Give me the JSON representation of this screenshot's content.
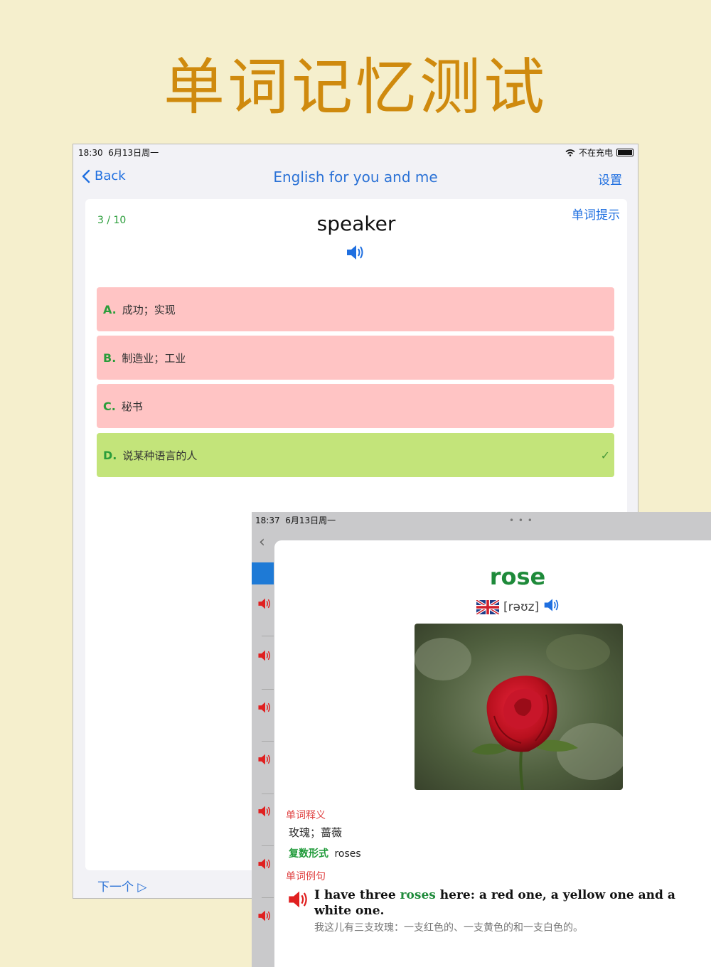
{
  "headline": "单词记忆测试",
  "back_screen": {
    "status": {
      "time": "18:30",
      "date": "6月13日周一",
      "charging": "不在充电"
    },
    "nav": {
      "back_label": "Back",
      "title": "English for you and me",
      "settings_label": "设置"
    },
    "quiz": {
      "progress": "3 / 10",
      "hint_label": "单词提示",
      "word": "speaker",
      "options": [
        {
          "letter": "A.",
          "text": "成功；实现",
          "state": "wrong"
        },
        {
          "letter": "B.",
          "text": "制造业；工业",
          "state": "wrong"
        },
        {
          "letter": "C.",
          "text": "秘书",
          "state": "wrong"
        },
        {
          "letter": "D.",
          "text": "说某种语言的人",
          "state": "correct",
          "mark": "✓"
        }
      ],
      "next_label": "下一个 ▷"
    }
  },
  "front_screen": {
    "status": {
      "time": "18:37",
      "date": "6月13日周一"
    },
    "word": "rose",
    "phonetic": "[rəʊz]",
    "meaning_label": "单词释义",
    "meaning": "玫瑰；蔷薇",
    "plural_label": "复数形式",
    "plural": "roses",
    "example_label": "单词例句",
    "example": {
      "before": "I have three ",
      "highlight": "roses",
      "after": " here: a red one, a yellow one and a white one."
    },
    "translation": "我这儿有三支玫瑰：一支红色的、一支黄色的和一支白色的。"
  },
  "colors": {
    "accent_blue": "#1f6fe0",
    "wrong": "#ffc4c4",
    "correct": "#c3e47a",
    "headline": "#cf8a0e",
    "word_green": "#1e8a3a",
    "label_red": "#e04343"
  },
  "icons": [
    "chevron-left-icon",
    "speaker-icon",
    "wifi-icon",
    "battery-icon",
    "uk-flag-icon",
    "checkmark-icon"
  ]
}
